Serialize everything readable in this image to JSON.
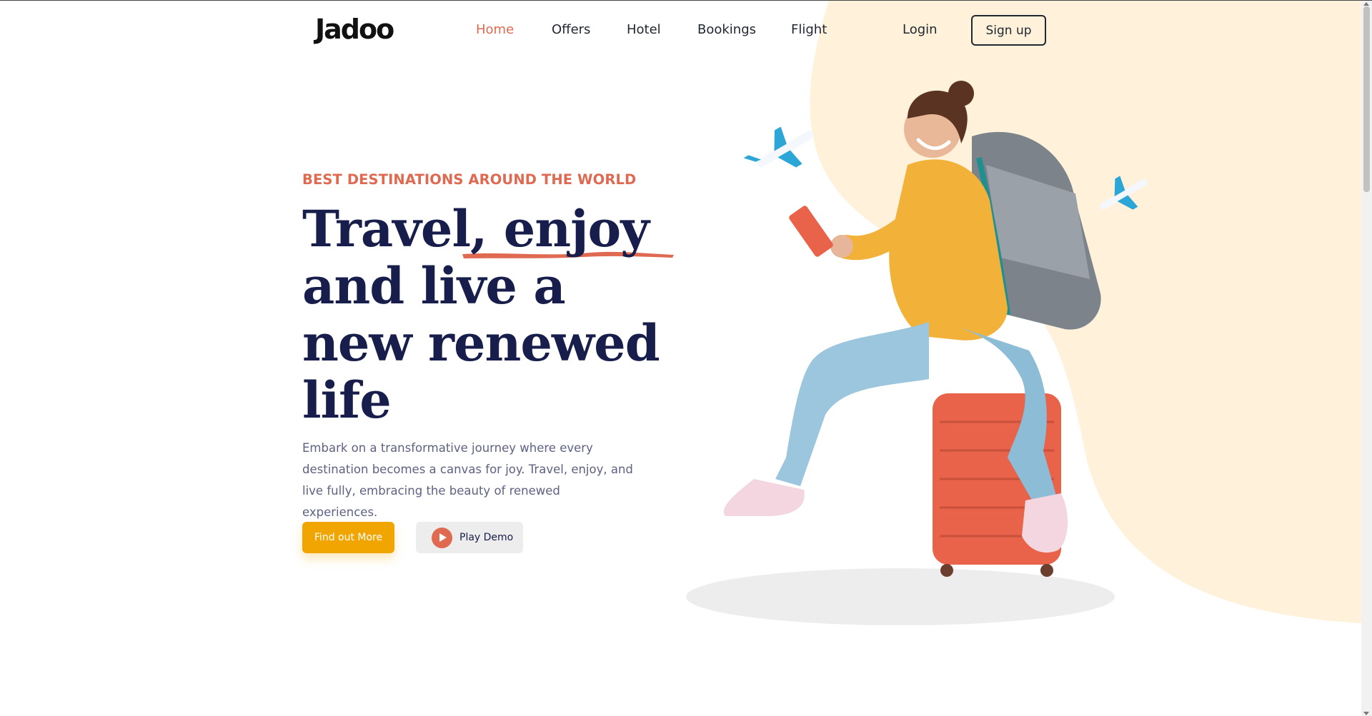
{
  "brand": {
    "logo_text": "Jadoo"
  },
  "nav": {
    "items": [
      {
        "label": "Home",
        "active": true
      },
      {
        "label": "Offers",
        "active": false
      },
      {
        "label": "Hotel",
        "active": false
      },
      {
        "label": "Bookings",
        "active": false
      },
      {
        "label": "Flight",
        "active": false
      }
    ],
    "login_label": "Login",
    "signup_label": "Sign up"
  },
  "hero": {
    "eyebrow": "BEST DESTINATIONS AROUND THE WORLD",
    "headline_lines": [
      "Travel, enjoy",
      "and live a",
      "new renewed",
      "life"
    ],
    "description": "Embark on a transformative journey where every destination becomes a canvas for joy. Travel, enjoy, and live fully, embracing the beauty of renewed experiences.",
    "primary_button": "Find out More",
    "demo_button": "Play Demo"
  },
  "colors": {
    "accent": "#DF6951",
    "primary_button": "#F1A501",
    "heading": "#181E4B",
    "body_text": "#5E6282",
    "blob": "#FFF1DA"
  },
  "icons": {
    "play": "play-icon",
    "plane": "airplane-icon"
  }
}
